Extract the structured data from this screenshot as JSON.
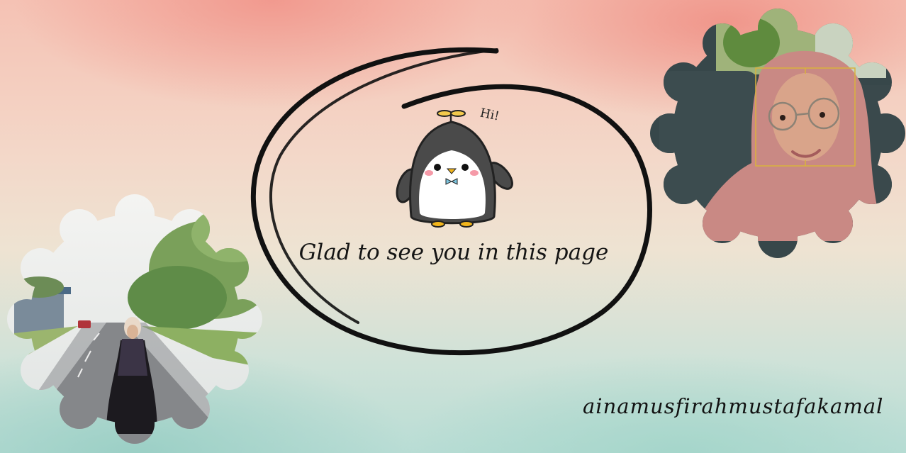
{
  "greeting": {
    "text": "Glad to see you in this page",
    "sticker_text": "Hi!"
  },
  "username": "ainamusfirahmustafakamal",
  "photos": [
    {
      "name": "road-photo",
      "description_icon": "person-standing-on-road-photo"
    },
    {
      "name": "selfie-photo",
      "description_icon": "selfie-with-face-frame-photo"
    }
  ],
  "colors": {
    "bg_top": "#f3a394",
    "bg_bottom": "#b9ddd5",
    "ink": "#111111",
    "penguin_dark": "#4a4a4a",
    "hijab": "#c98984"
  }
}
